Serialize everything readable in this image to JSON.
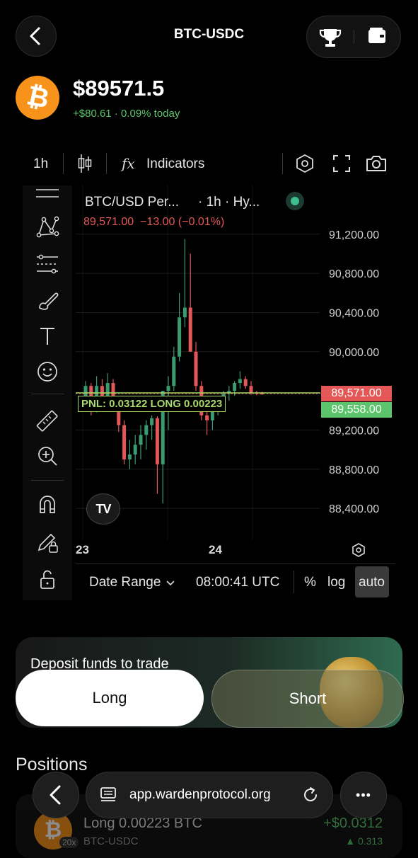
{
  "header": {
    "title": "BTC-USDC"
  },
  "asset": {
    "symbol_glyph": "₿",
    "price": "$89571.5",
    "change": "+$80.61 · 0.09% today",
    "brand_color": "#F7931A",
    "positive_color": "#5CC46A"
  },
  "toolbar": {
    "interval": "1h",
    "indicators_label": "Indicators",
    "indicators_glyph": "fx"
  },
  "chart": {
    "symbol_label": "BTC/USD Per...",
    "interval_label": "· 1h · Hy...",
    "ohlc": "89,571.00  −13.00 (−0.01%)",
    "pnl_label": "PNL: 0.03122 LONG 0.00223",
    "price_tag_last": "89,571.00",
    "price_tag_entry": "89,558.00",
    "x_labels": [
      "23",
      "24"
    ],
    "date_range_label": "Date Range",
    "time_label": "08:00:41 UTC",
    "percent_label": "%",
    "log_label": "log",
    "auto_label": "auto",
    "logo_text": "TV"
  },
  "chart_data": {
    "type": "candlestick",
    "y_axis_labels": [
      "91,200.00",
      "90,800.00",
      "90,400.00",
      "90,000.00",
      "89,200.00",
      "88,800.00",
      "88,400.00"
    ],
    "ylim": [
      88300,
      91350
    ],
    "last_price": 89571,
    "entry_price": 89558,
    "up_color": "#3B9A6E",
    "down_color": "#E45757",
    "candles": [
      {
        "o": 89500,
        "h": 89700,
        "l": 89450,
        "c": 89650
      },
      {
        "o": 89650,
        "h": 89680,
        "l": 89350,
        "c": 89400
      },
      {
        "o": 89400,
        "h": 89750,
        "l": 89380,
        "c": 89650
      },
      {
        "o": 89650,
        "h": 89720,
        "l": 89450,
        "c": 89500
      },
      {
        "o": 89500,
        "h": 89780,
        "l": 89480,
        "c": 89680
      },
      {
        "o": 89680,
        "h": 89720,
        "l": 89500,
        "c": 89500
      },
      {
        "o": 89500,
        "h": 89550,
        "l": 89180,
        "c": 89250
      },
      {
        "o": 89250,
        "h": 89300,
        "l": 88850,
        "c": 88900
      },
      {
        "o": 88900,
        "h": 89100,
        "l": 88800,
        "c": 88950
      },
      {
        "o": 88950,
        "h": 89150,
        "l": 88850,
        "c": 89050
      },
      {
        "o": 89050,
        "h": 89250,
        "l": 88900,
        "c": 89150
      },
      {
        "o": 89150,
        "h": 89300,
        "l": 89000,
        "c": 89250
      },
      {
        "o": 89250,
        "h": 89350,
        "l": 89100,
        "c": 89320
      },
      {
        "o": 89320,
        "h": 89340,
        "l": 88550,
        "c": 88850
      },
      {
        "o": 88850,
        "h": 89600,
        "l": 88450,
        "c": 89600
      },
      {
        "o": 89600,
        "h": 89750,
        "l": 89200,
        "c": 89650
      },
      {
        "o": 89650,
        "h": 90050,
        "l": 89600,
        "c": 89950
      },
      {
        "o": 89950,
        "h": 90600,
        "l": 89900,
        "c": 90350
      },
      {
        "o": 90350,
        "h": 91150,
        "l": 90250,
        "c": 90450
      },
      {
        "o": 90450,
        "h": 91000,
        "l": 90000,
        "c": 90000
      },
      {
        "o": 90000,
        "h": 90100,
        "l": 89600,
        "c": 89650
      },
      {
        "o": 89650,
        "h": 89700,
        "l": 89300,
        "c": 89350
      },
      {
        "o": 89350,
        "h": 89500,
        "l": 89150,
        "c": 89300
      },
      {
        "o": 89300,
        "h": 89450,
        "l": 89200,
        "c": 89400
      },
      {
        "o": 89400,
        "h": 89550,
        "l": 89350,
        "c": 89500
      },
      {
        "o": 89500,
        "h": 89600,
        "l": 89450,
        "c": 89570
      },
      {
        "o": 89570,
        "h": 89650,
        "l": 89500,
        "c": 89600
      },
      {
        "o": 89600,
        "h": 89700,
        "l": 89550,
        "c": 89680
      },
      {
        "o": 89680,
        "h": 89800,
        "l": 89620,
        "c": 89720
      },
      {
        "o": 89720,
        "h": 89750,
        "l": 89620,
        "c": 89650
      },
      {
        "o": 89650,
        "h": 89700,
        "l": 89560,
        "c": 89580
      },
      {
        "o": 89580,
        "h": 89600,
        "l": 89555,
        "c": 89575
      },
      {
        "o": 89575,
        "h": 89590,
        "l": 89560,
        "c": 89571
      }
    ]
  },
  "trade": {
    "deposit_text": "Deposit funds to trade",
    "long_label": "Long",
    "short_label": "Short"
  },
  "positions": {
    "heading": "Positions",
    "item": {
      "leverage": "20x",
      "title": "Long 0.00223 BTC",
      "pair": "BTC-USDC",
      "pnl": "+$0.0312",
      "pnl_sub": "▲ 0.313"
    }
  },
  "browser": {
    "url": "app.wardenprotocol.org",
    "more_glyph": "•••"
  }
}
